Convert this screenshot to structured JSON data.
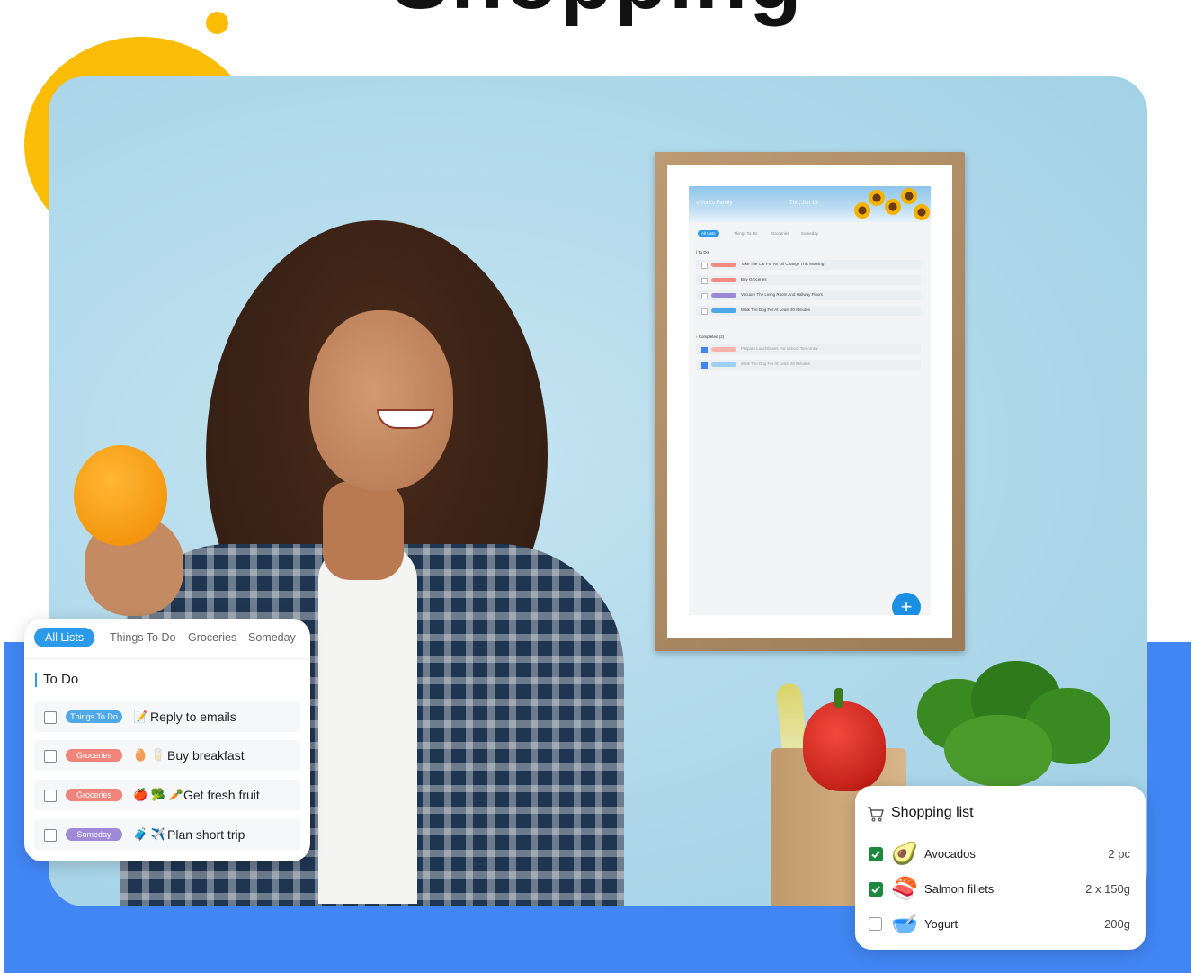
{
  "headline": {
    "text": "Shopping"
  },
  "wall_display": {
    "header_left": "≡ York's Family",
    "header_center": "Thu, Jun 19",
    "tabs": [
      "All Lists",
      "Things To Do",
      "Groceries",
      "Someday"
    ],
    "section_todo": "| To Do",
    "todo_items": [
      {
        "text": "Take The Car For An Oil Change This Morning",
        "tag_color": "#f28b82"
      },
      {
        "text": "Buy Groceries",
        "tag_color": "#f28b82"
      },
      {
        "text": "Vacuum The Living Room And Hallway Floors",
        "tag_color": "#9a8ad6"
      },
      {
        "text": "Walk The Dog For At Least 30 Minutes",
        "tag_color": "#4fa8e8"
      }
    ],
    "section_completed": "› Completed (2)",
    "completed_items": [
      {
        "text": "Prepare Lunchboxes For School Tomorrow",
        "tag_color": "#f6b3ad"
      },
      {
        "text": "Walk The Dog For At Least 30 Minutes",
        "tag_color": "#9ccff1"
      }
    ],
    "fab_label": "+"
  },
  "todo_card": {
    "tabs": [
      "All Lists",
      "Things To Do",
      "Groceries",
      "Someday"
    ],
    "section_title": "To Do",
    "items": [
      {
        "tag": "Things To Do",
        "tag_color": "#4fa8e8",
        "emoji": "📝",
        "label": "Reply to emails"
      },
      {
        "tag": "Groceries",
        "tag_color": "#f0837a",
        "emoji": "🥚 🥛",
        "label": "Buy breakfast"
      },
      {
        "tag": "Groceries",
        "tag_color": "#f0837a",
        "emoji": "🍎 🥦 🥕",
        "label": "Get fresh fruit"
      },
      {
        "tag": "Someday",
        "tag_color": "#a08ad8",
        "emoji": "🧳 ✈️",
        "label": "Plan short trip"
      }
    ]
  },
  "shopping_card": {
    "title": "Shopping list",
    "icon": "cart-icon",
    "items": [
      {
        "checked": true,
        "emoji": "🥑",
        "name": "Avocados",
        "qty": "2 pc"
      },
      {
        "checked": true,
        "emoji": "🍣",
        "name": "Salmon fillets",
        "qty": "2 x 150g"
      },
      {
        "checked": false,
        "emoji": "🥣",
        "name": "Yogurt",
        "qty": "200g"
      }
    ]
  },
  "colors": {
    "accent_yellow": "#fbbc05",
    "band_blue": "#4286f4",
    "tab_blue": "#2b9ae8",
    "check_green": "#1b8a3e"
  }
}
